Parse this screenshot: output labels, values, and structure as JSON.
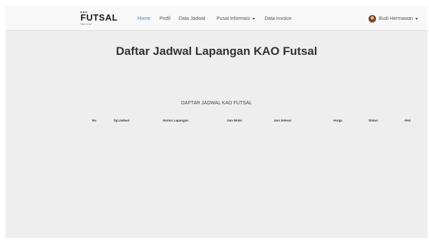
{
  "brand": {
    "top_text": "KAO",
    "name": "FUTSAL",
    "tagline": "futsal center"
  },
  "nav": {
    "items": [
      {
        "label": "Home",
        "active": true
      },
      {
        "label": "Profil"
      },
      {
        "label": "Data Jadwal"
      },
      {
        "label": "Pusat Informasi",
        "dropdown": true
      },
      {
        "label": "Data Invoice"
      }
    ],
    "user": {
      "name": "Budi Hermawan",
      "dropdown": true
    }
  },
  "main": {
    "title": "Daftar Jadwal Lapangan KAO Futsal",
    "table_caption": "DAFTAR JADWAL KAO FUTSAL",
    "columns": [
      "No",
      "Tgl.Jadwal",
      "Nomor Lapangan",
      "Jam Mulai",
      "Jam Selesai",
      "Harga",
      "Status",
      "Aksi"
    ],
    "rows": []
  },
  "colors": {
    "navbar_bg": "#f8f8f8",
    "page_bg": "#eeeeee",
    "active_link": "#3c8dbc"
  }
}
